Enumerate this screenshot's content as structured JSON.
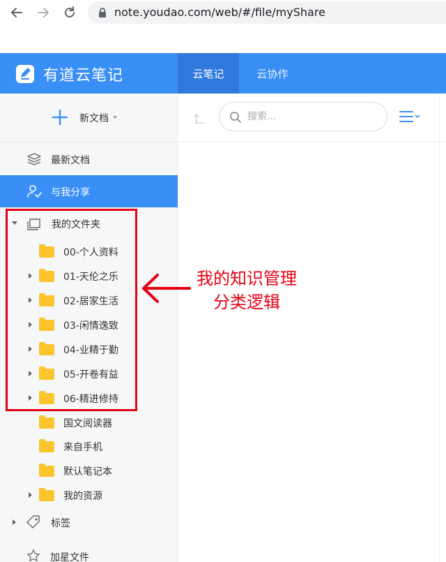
{
  "browser": {
    "url": "note.youdao.com/web/#/file/myShare"
  },
  "header": {
    "title": "有道云笔记",
    "tabs": [
      {
        "label": "云笔记",
        "active": true
      },
      {
        "label": "云协作",
        "active": false
      }
    ]
  },
  "sidebar": {
    "new_doc_label": "新文档",
    "items": [
      {
        "label": "最新文档"
      },
      {
        "label": "与我分享",
        "active": true
      }
    ],
    "my_folders_label": "我的文件夹",
    "folders": [
      {
        "label": "00-个人资料",
        "expandable": false
      },
      {
        "label": "01-天伦之乐",
        "expandable": true
      },
      {
        "label": "02-居家生活",
        "expandable": true
      },
      {
        "label": "03-闲情逸致",
        "expandable": true
      },
      {
        "label": "04-业精于勤",
        "expandable": true
      },
      {
        "label": "05-开卷有益",
        "expandable": true
      },
      {
        "label": "06-精进修持",
        "expandable": true
      },
      {
        "label": "国文阅读器",
        "expandable": false
      },
      {
        "label": "来自手机",
        "expandable": false
      },
      {
        "label": "默认笔记本",
        "expandable": false
      },
      {
        "label": "我的资源",
        "expandable": true
      }
    ],
    "tags_label": "标签",
    "partial_label": "加星文件"
  },
  "toolbar": {
    "search_placeholder": "搜索..."
  },
  "annotation": {
    "line1": "我的知识管理",
    "line2": "分类逻辑"
  },
  "colors": {
    "brand_blue": "#3a8ff7",
    "active_tab": "#2f79dc",
    "folder_yellow": "#fcc52d",
    "annotation_red": "#e60012"
  }
}
